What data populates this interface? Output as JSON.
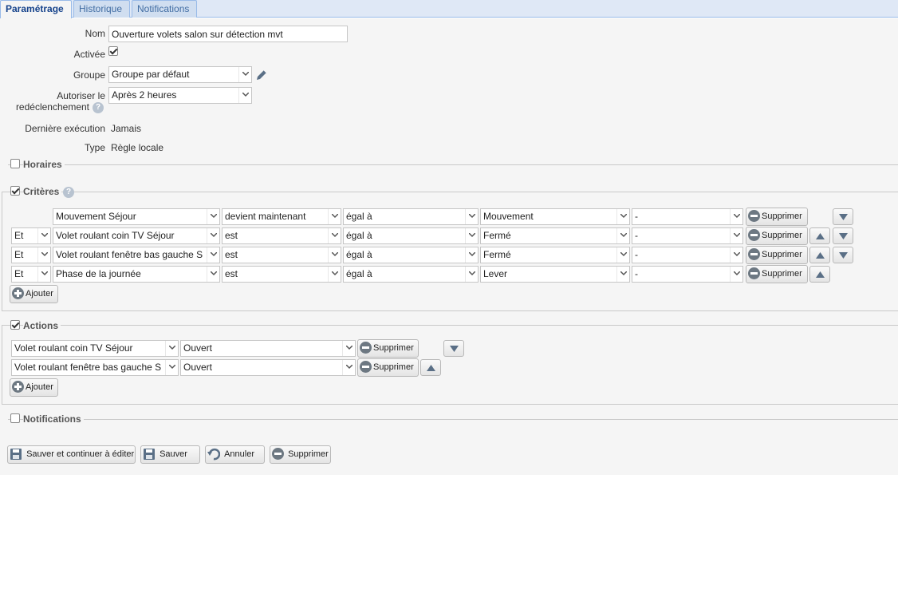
{
  "tabs": [
    "Paramétrage",
    "Historique",
    "Notifications"
  ],
  "form": {
    "nom_label": "Nom",
    "nom_value": "Ouverture volets salon sur détection mvt",
    "activee_label": "Activée",
    "groupe_label": "Groupe",
    "groupe_value": "Groupe par défaut",
    "autoriser_label_1": "Autoriser le",
    "autoriser_label_2": "redéclenchement",
    "autoriser_value": "Après 2 heures",
    "derniere_label": "Dernière exécution",
    "derniere_value": "Jamais",
    "type_label": "Type",
    "type_value": "Règle locale"
  },
  "sections": {
    "horaires": "Horaires",
    "criteres": "Critères",
    "actions": "Actions",
    "notifications": "Notifications"
  },
  "criteria": [
    {
      "op": "",
      "device": "Mouvement Séjour",
      "cond": "devient maintenant",
      "cmp": "égal à",
      "value": "Mouvement",
      "extra": "-"
    },
    {
      "op": "Et",
      "device": "Volet roulant coin TV Séjour",
      "cond": "est",
      "cmp": "égal à",
      "value": "Fermé",
      "extra": "-"
    },
    {
      "op": "Et",
      "device": "Volet roulant fenêtre bas gauche S",
      "cond": "est",
      "cmp": "égal à",
      "value": "Fermé",
      "extra": "-"
    },
    {
      "op": "Et",
      "device": "Phase de la journée",
      "cond": "est",
      "cmp": "égal à",
      "value": "Lever",
      "extra": "-"
    }
  ],
  "actions": [
    {
      "device": "Volet roulant coin TV Séjour",
      "value": "Ouvert"
    },
    {
      "device": "Volet roulant fenêtre bas gauche S",
      "value": "Ouvert"
    }
  ],
  "buttons": {
    "supprimer": "Supprimer",
    "ajouter": "Ajouter",
    "save_continue": "Sauver et continuer à éditer",
    "save": "Sauver",
    "cancel": "Annuler",
    "delete": "Supprimer"
  },
  "help_glyph": "?"
}
